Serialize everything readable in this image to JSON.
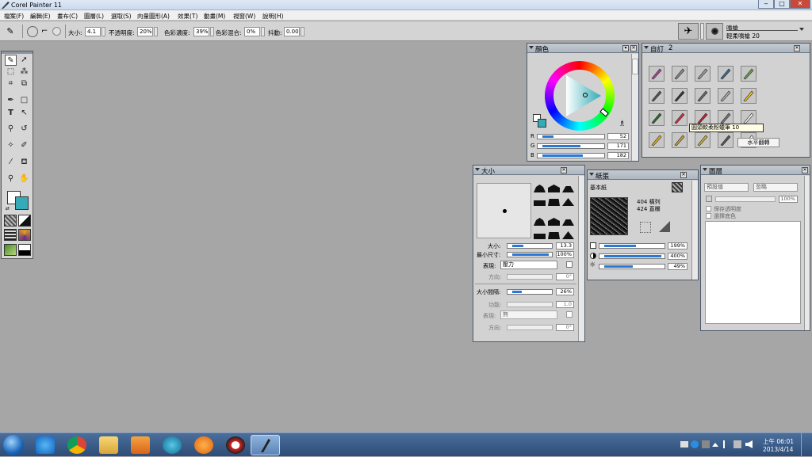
{
  "window": {
    "title": "Corel Painter 11",
    "min": "‒",
    "max": "□",
    "close": "✕"
  },
  "menu": [
    "檔案(F)",
    "編輯(E)",
    "畫布(C)",
    "圖層(L)",
    "選取(S)",
    "向量圖形(A)",
    "效果(T)",
    "動畫(M)",
    "視窗(W)",
    "說明(H)"
  ],
  "props": {
    "size_label": "大小:",
    "size": "4.1",
    "opacity_label": "不透明度:",
    "opacity": "20%",
    "conc_label": "色彩濃度:",
    "conc": "39%",
    "mix_label": "色彩混合:",
    "mix": "0%",
    "jitter_label": "抖動:",
    "jitter": "0.00"
  },
  "brush_selector": {
    "category": "噴槍",
    "variant": "輕柔噴槍 20"
  },
  "color_panel": {
    "title": "顏色",
    "r_label": "R",
    "g_label": "G",
    "b_label": "B",
    "r": "52",
    "g": "171",
    "b": "182",
    "r_frac": 0.2,
    "g_frac": 0.67,
    "b_frac": 0.71,
    "main_color": "#34abb6",
    "accent_color": "#2a78d6"
  },
  "custom_panel": {
    "title": "自訂",
    "number": "2",
    "tooltip": "圓頭軟柔粉蠟筆 10",
    "button": "水平翻轉"
  },
  "size_panel": {
    "title": "大小",
    "size_label": "大小:",
    "size": "13.3",
    "min_label": "最小尺寸:",
    "min": "100%",
    "expr_label": "表現:",
    "expr": "壓力",
    "dir_label": "方向:",
    "dir": "0°",
    "step_label": "大小間隔:",
    "step": "26%",
    "func_label": "功能:",
    "func": "1.0",
    "expr2_label": "表現:",
    "expr2": "無",
    "dir2_label": "方向:",
    "dir2": "0°"
  },
  "paper_panel": {
    "title": "紙張",
    "name": "基本紙",
    "rows": "404 橫列",
    "cols": "424 直欄",
    "scale": "199%",
    "contrast": "400%",
    "brightness": "49%"
  },
  "layers_panel": {
    "title": "圖層",
    "composite": "預設值",
    "method": "忽略",
    "opacity": "100%",
    "preserve": "保存透明度",
    "pick": "選擇底色"
  },
  "clock": {
    "time": "上午 06:01",
    "date": "2013/4/14"
  }
}
